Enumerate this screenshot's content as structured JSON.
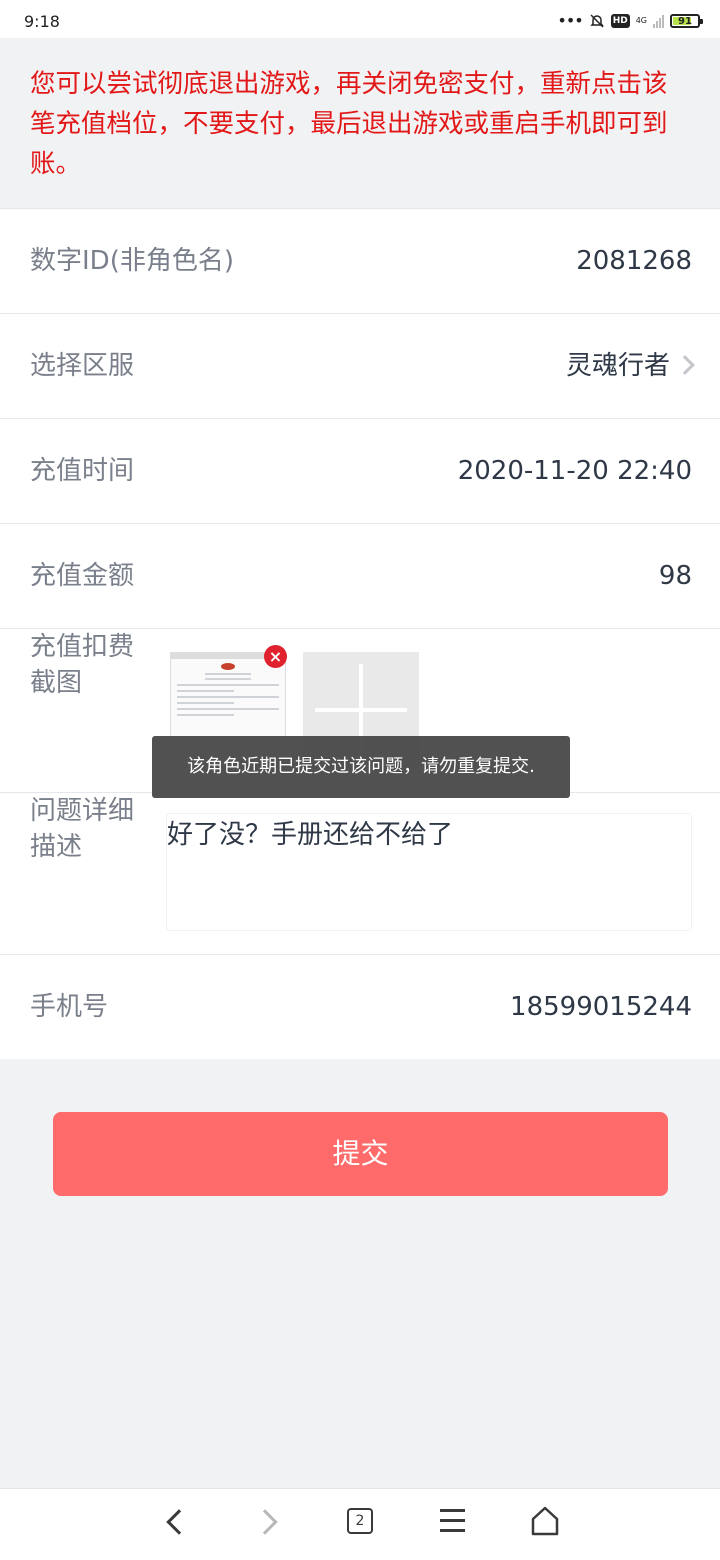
{
  "status_bar": {
    "time": "9:18",
    "dots": "•••",
    "hd": "HD",
    "network": "4G",
    "battery": "91"
  },
  "notice": "您可以尝试彻底退出游戏，再关闭免密支付，重新点击该笔充值档位，不要支付，最后退出游戏或重启手机即可到账。",
  "form": {
    "id_label": "数字ID(非角色名)",
    "id_value": "2081268",
    "server_label": "选择区服",
    "server_value": "灵魂行者",
    "time_label": "充值时间",
    "time_value": "2020-11-20 22:40",
    "amount_label": "充值金额",
    "amount_value": "98",
    "screenshot_label": "充值扣费截图",
    "desc_label": "问题详细描述",
    "desc_value": "好了没？手册还给不给了",
    "phone_label": "手机号",
    "phone_value": "18599015244"
  },
  "toast": "该角色近期已提交过该问题，请勿重复提交.",
  "submit_label": "提交",
  "bottom_nav": {
    "tab_count": "2"
  },
  "colors": {
    "notice": "#e21818",
    "submit": "#ff6a6a",
    "background": "#f1f2f4"
  }
}
